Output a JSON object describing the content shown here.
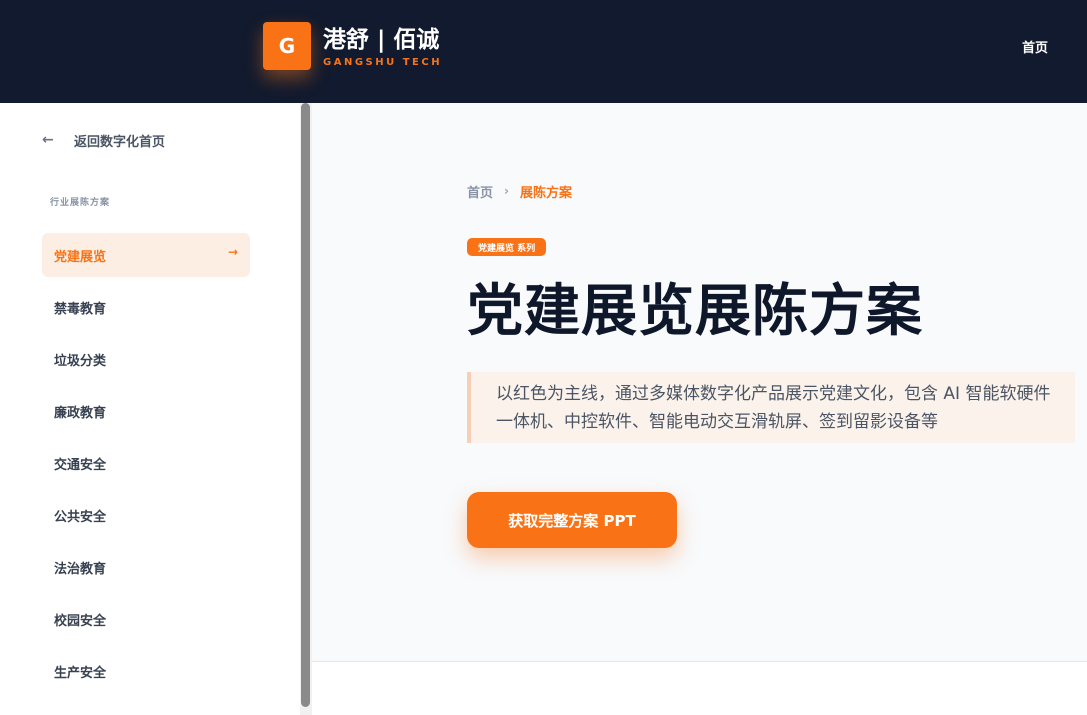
{
  "header": {
    "logo_letter": "G",
    "brand_name": "港舒 | 佰诚",
    "brand_sub": "GANGSHU TECH",
    "nav_home": "首页"
  },
  "sidebar": {
    "back_label": "返回数字化首页",
    "section_label": "行业展陈方案",
    "items": [
      {
        "label": "党建展览",
        "active": true
      },
      {
        "label": "禁毒教育"
      },
      {
        "label": "垃圾分类"
      },
      {
        "label": "廉政教育"
      },
      {
        "label": "交通安全"
      },
      {
        "label": "公共安全"
      },
      {
        "label": "法治教育"
      },
      {
        "label": "校园安全"
      },
      {
        "label": "生产安全"
      }
    ]
  },
  "breadcrumb": {
    "home": "首页",
    "separator": "›",
    "current": "展陈方案"
  },
  "main": {
    "tag": "党建展览 系列",
    "title": "党建展览展陈方案",
    "description": "以红色为主线，通过多媒体数字化产品展示党建文化，包含 AI 智能软硬件一体机、中控软件、智能电动交互滑轨屏、签到留影设备等",
    "cta_label": "获取完整方案 PPT"
  },
  "colors": {
    "accent": "#f97316",
    "header_bg": "#111a2e",
    "title_text": "#0f172a"
  },
  "icons": {
    "back": "arrow-left-icon",
    "active_item": "arrow-right-icon",
    "breadcrumb_separator": "chevron-right-icon"
  }
}
